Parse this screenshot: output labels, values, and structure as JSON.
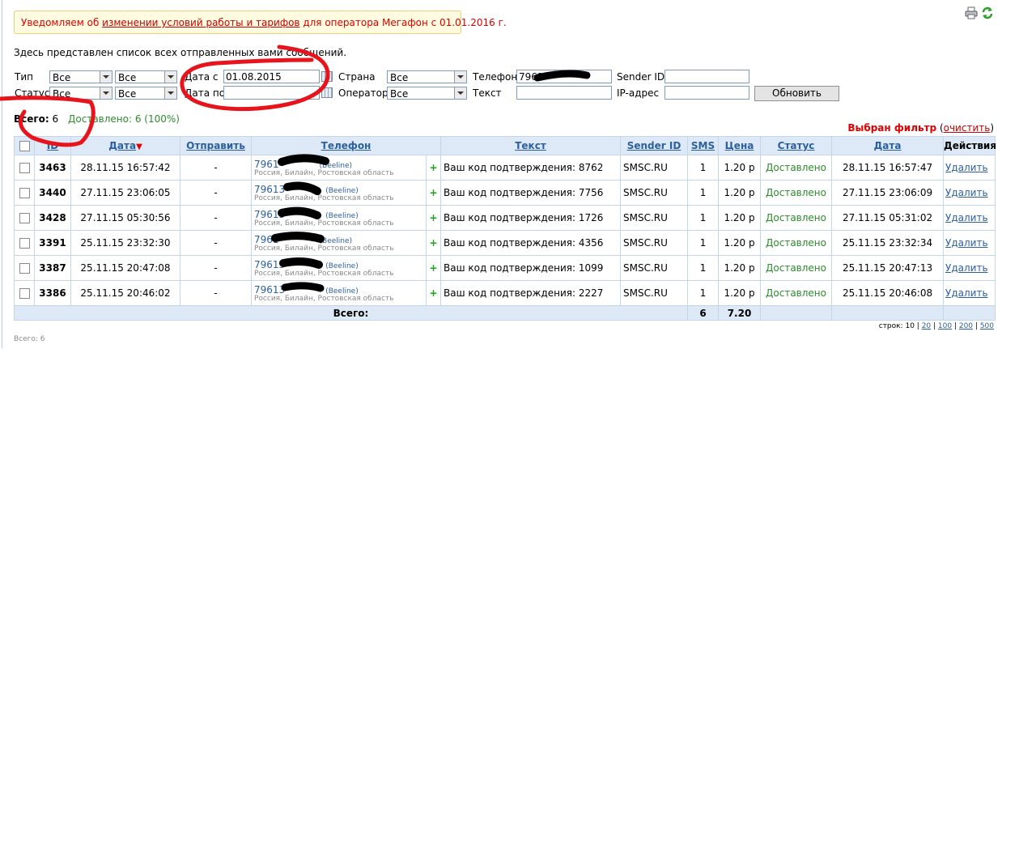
{
  "notice": {
    "prefix": "Уведомляем об ",
    "link": "изменении условий работы и тарифов",
    "suffix": " для оператора Мегафон с 01.01.2016 г."
  },
  "intro": "Здесь представлен список всех отправленных вами сообщений.",
  "icons": {
    "print": "printer-icon",
    "refresh": "refresh-icon"
  },
  "filters": {
    "type_label": "Тип",
    "type_value_1": "Все",
    "type_value_2": "Все",
    "status_label": "Статус",
    "status_value_1": "Все",
    "status_value_2": "Все",
    "date_from_label": "Дата с",
    "date_from_value": "01.08.2015",
    "date_to_label": "Дата по",
    "date_to_value": "",
    "country_label": "Страна",
    "country_value": "Все",
    "operator_label": "Оператор",
    "operator_value": "Все",
    "phone_label": "Телефон",
    "phone_value": "7961",
    "text_label": "Текст",
    "text_value": "",
    "sender_label": "Sender ID",
    "sender_value": "",
    "ip_label": "IP-адрес",
    "ip_value": "",
    "refresh_button": "Обновить"
  },
  "totals": {
    "label": "Всего:",
    "count": "6",
    "delivered": "Доставлено: 6 (100%)"
  },
  "filter_notice": {
    "label": "Выбран фильтр",
    "clear": "очистить"
  },
  "table": {
    "headers": {
      "id": "ID",
      "date": "Дата",
      "send": "Отправить",
      "phone": "Телефон",
      "text": "Текст",
      "sender": "Sender ID",
      "sms": "SMS",
      "price": "Цена",
      "status": "Статус",
      "date2": "Дата",
      "actions": "Действия"
    },
    "sort_arrow": "▼",
    "rows": [
      {
        "id": "3463",
        "date": "28.11.15 16:57:42",
        "send": "-",
        "phone": "7961",
        "op": "(Beeline)",
        "loc": "Россия, Билайн, Ростовская область",
        "plus": "+",
        "text": "Ваш код подтверждения: 8762",
        "sender": "SMSC.RU",
        "sms": "1",
        "price": "1.20 р",
        "status": "Доставлено",
        "date2": "28.11.15 16:57:47",
        "action": "Удалить"
      },
      {
        "id": "3440",
        "date": "27.11.15 23:06:05",
        "send": "-",
        "phone": "79613",
        "op": "(Beeline)",
        "loc": "Россия, Билайн, Ростовская область",
        "plus": "+",
        "text": "Ваш код подтверждения: 7756",
        "sender": "SMSC.RU",
        "sms": "1",
        "price": "1.20 р",
        "status": "Доставлено",
        "date2": "27.11.15 23:06:09",
        "action": "Удалить"
      },
      {
        "id": "3428",
        "date": "27.11.15 05:30:56",
        "send": "-",
        "phone": "79613",
        "op": "(Beeline)",
        "loc": "Россия, Билайн, Ростовская область",
        "plus": "+",
        "text": "Ваш код подтверждения: 1726",
        "sender": "SMSC.RU",
        "sms": "1",
        "price": "1.20 р",
        "status": "Доставлено",
        "date2": "27.11.15 05:31:02",
        "action": "Удалить"
      },
      {
        "id": "3391",
        "date": "25.11.15 23:32:30",
        "send": "-",
        "phone": "7961",
        "op": "(Beeline)",
        "loc": "Россия, Билайн, Ростовская область",
        "plus": "+",
        "text": "Ваш код подтверждения: 4356",
        "sender": "SMSC.RU",
        "sms": "1",
        "price": "1.20 р",
        "status": "Доставлено",
        "date2": "25.11.15 23:32:34",
        "action": "Удалить"
      },
      {
        "id": "3387",
        "date": "25.11.15 20:47:08",
        "send": "-",
        "phone": "79613",
        "op": "(Beeline)",
        "loc": "Россия, Билайн, Ростовская область",
        "plus": "+",
        "text": "Ваш код подтверждения: 1099",
        "sender": "SMSC.RU",
        "sms": "1",
        "price": "1.20 р",
        "status": "Доставлено",
        "date2": "25.11.15 20:47:13",
        "action": "Удалить"
      },
      {
        "id": "3386",
        "date": "25.11.15 20:46:02",
        "send": "-",
        "phone": "79613",
        "op": "(Beeline)",
        "loc": "Россия, Билайн, Ростовская область",
        "plus": "+",
        "text": "Ваш код подтверждения: 2227",
        "sender": "SMSC.RU",
        "sms": "1",
        "price": "1.20 р",
        "status": "Доставлено",
        "date2": "25.11.15 20:46:08",
        "action": "Удалить"
      }
    ],
    "footer": {
      "label": "Всего:",
      "sms": "6",
      "price": "7.20"
    }
  },
  "pager": {
    "label": "строк:",
    "current": "10",
    "options": [
      "20",
      "100",
      "200",
      "500"
    ]
  },
  "bottom_total": "Всего: 6",
  "colors": {
    "notice_text": "#e00000",
    "link_blue": "#2b5fa0",
    "status_green": "#2e8b2e",
    "header_bg": "#dde9f6",
    "annotation_red": "#e8141c"
  }
}
